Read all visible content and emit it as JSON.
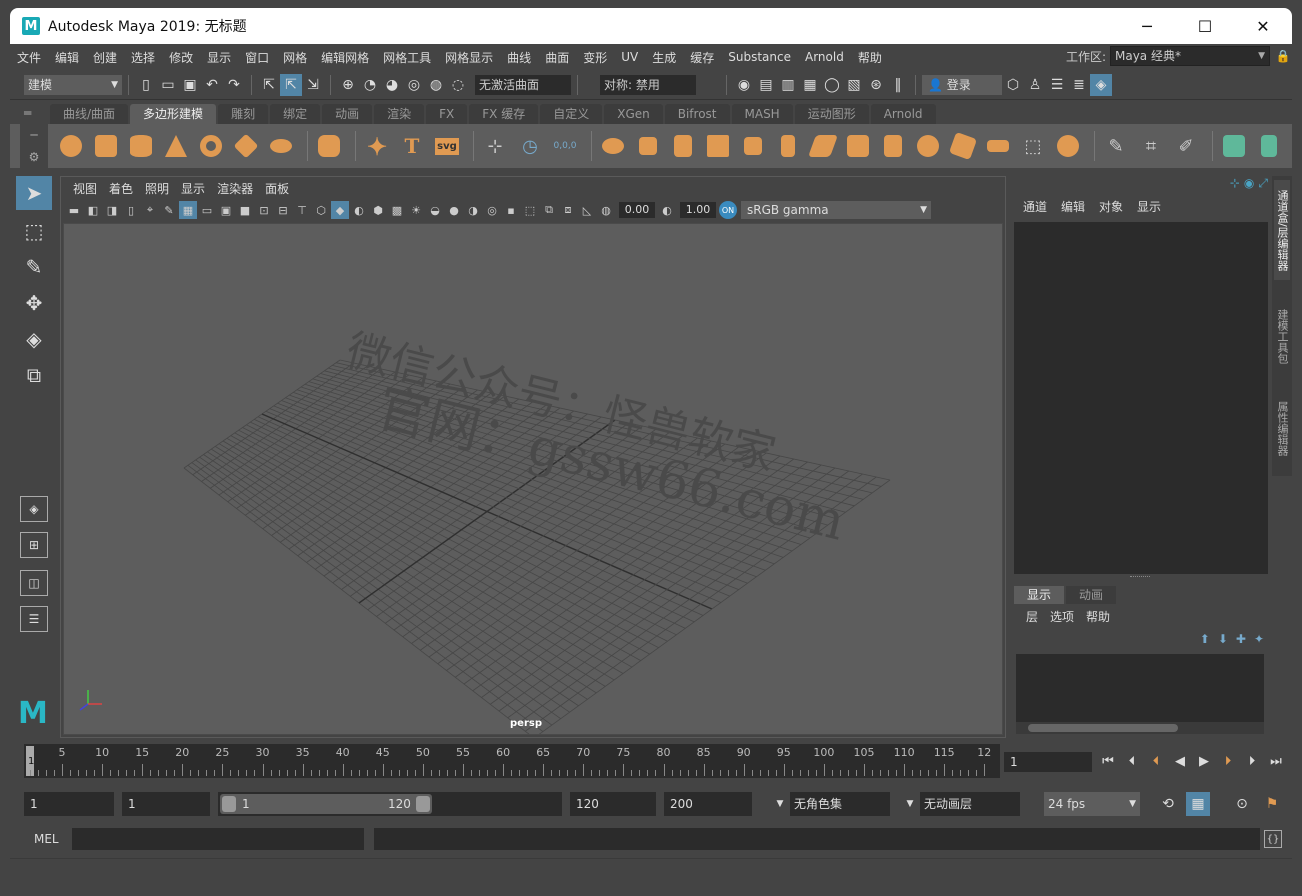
{
  "window": {
    "title": "Autodesk Maya 2019: 无标题",
    "logo": "M",
    "controls": {
      "minimize": "─",
      "maximize": "☐",
      "close": "✕"
    }
  },
  "menubar": {
    "items": [
      "文件",
      "编辑",
      "创建",
      "选择",
      "修改",
      "显示",
      "窗口",
      "网格",
      "编辑网格",
      "网格工具",
      "网格显示",
      "曲线",
      "曲面",
      "变形",
      "UV",
      "生成",
      "缓存",
      "Substance",
      "Arnold",
      "帮助"
    ],
    "workspace_label": "工作区:",
    "workspace_value": "Maya 经典*"
  },
  "statusline": {
    "mode": "建模",
    "live_surface": "无激活曲面",
    "symmetry": "对称: 禁用",
    "login": "登录"
  },
  "shelf": {
    "tabs": [
      "曲线/曲面",
      "多边形建模",
      "雕刻",
      "绑定",
      "动画",
      "渲染",
      "FX",
      "FX 缓存",
      "自定义",
      "XGen",
      "Bifrost",
      "MASH",
      "运动图形",
      "Arnold"
    ],
    "active_tab": 1,
    "svg_label": "svg",
    "text_label": "T",
    "coord_label": "0,0,0"
  },
  "viewport": {
    "menu": [
      "视图",
      "着色",
      "照明",
      "显示",
      "渲染器",
      "面板"
    ],
    "exposure": "0.00",
    "gamma": "1.00",
    "color_space": "sRGB gamma",
    "on_label": "ON",
    "camera": "persp",
    "watermark_line1": "微信公众号：怪兽软家",
    "watermark_line2": "官网：gssw66.com"
  },
  "channel_box": {
    "menu": [
      "通道",
      "编辑",
      "对象",
      "显示"
    ]
  },
  "layer_editor": {
    "tabs": [
      "显示",
      "动画"
    ],
    "menu": [
      "层",
      "选项",
      "帮助"
    ]
  },
  "side_tabs": [
    "通道盒/层编辑器",
    "建模工具包",
    "属性编辑器"
  ],
  "timeline": {
    "current_frame": "1",
    "tick_labels": [
      "5",
      "10",
      "15",
      "20",
      "25",
      "30",
      "35",
      "40",
      "45",
      "50",
      "55",
      "60",
      "65",
      "70",
      "75",
      "80",
      "85",
      "90",
      "95",
      "100",
      "105",
      "110",
      "115",
      "12"
    ],
    "frame_field": "1"
  },
  "range": {
    "start_anim": "1",
    "start_play": "1",
    "slider_start": "1",
    "slider_end": "120",
    "end_play": "120",
    "end_anim": "200",
    "character_set": "无角色集",
    "anim_layer": "无动画层",
    "fps": "24 fps"
  },
  "cmdline": {
    "label": "MEL"
  }
}
